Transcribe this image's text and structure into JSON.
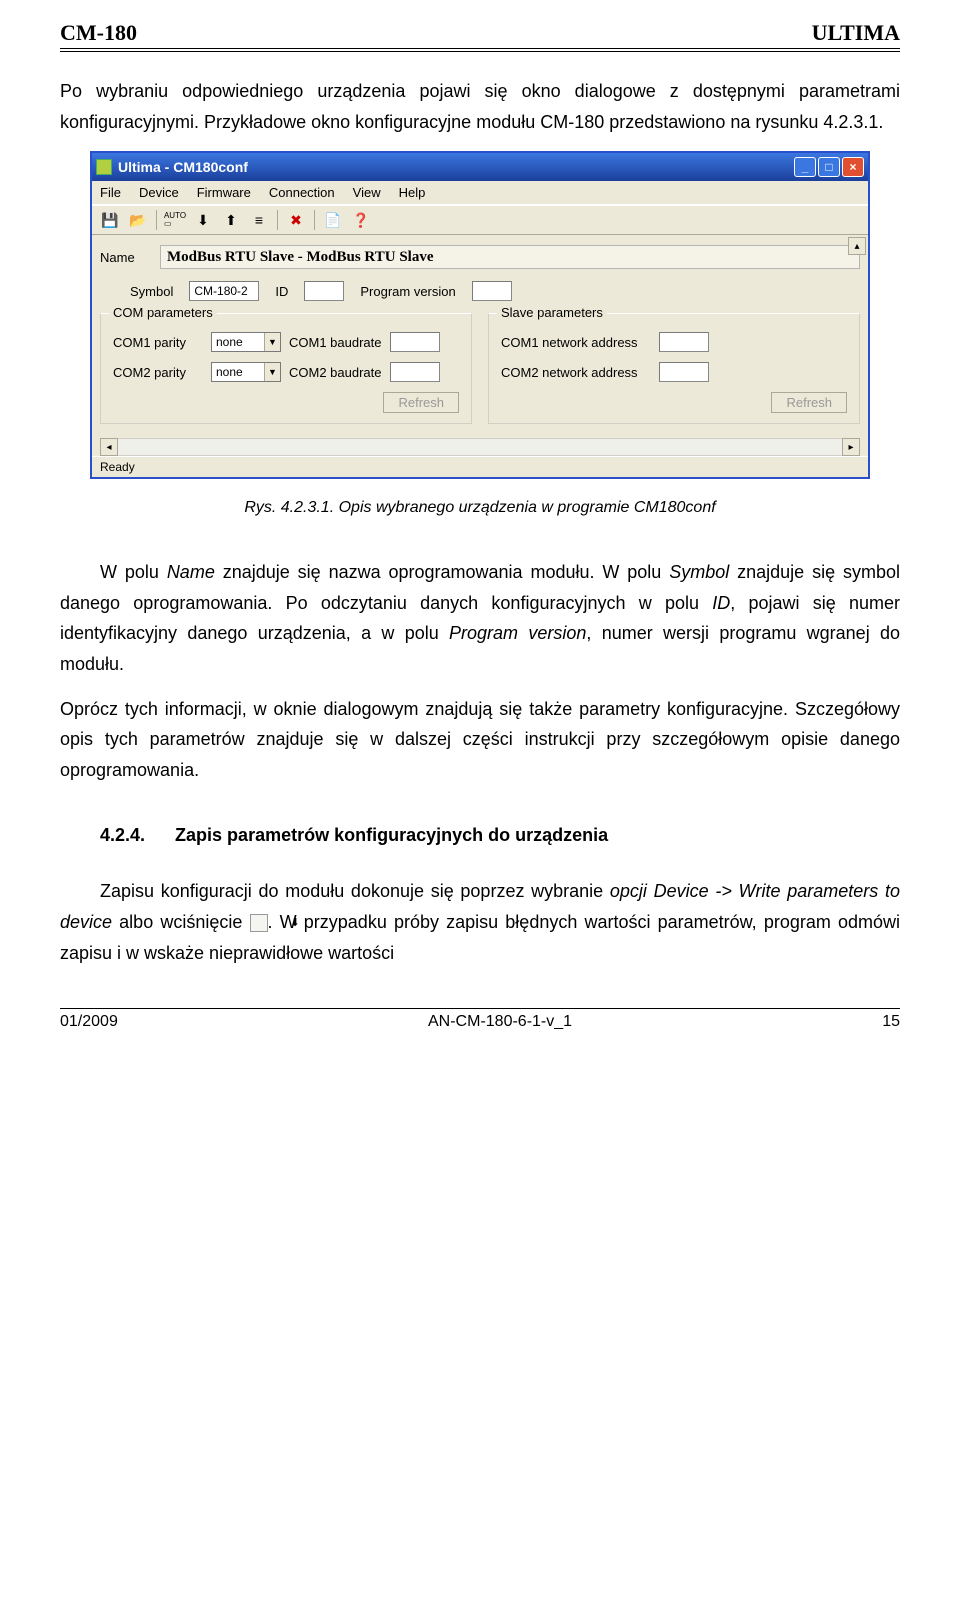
{
  "header": {
    "left": "CM-180",
    "right": "ULTIMA"
  },
  "intro": "Po wybraniu odpowiedniego urządzenia pojawi się okno dialogowe z dostępnymi parametrami konfiguracyjnymi. Przykładowe okno konfiguracyjne modułu CM-180 przedstawiono na rysunku 4.2.3.1.",
  "window": {
    "title": "Ultima - CM180conf",
    "menu": [
      "File",
      "Device",
      "Firmware",
      "Connection",
      "View",
      "Help"
    ],
    "toolbar_icons": [
      "save-icon",
      "open-icon",
      "auto-icon",
      "download-icon",
      "upload-icon",
      "verify-icon",
      "stop-icon",
      "doc-icon",
      "help-icon"
    ],
    "labels": {
      "name": "Name",
      "symbol": "Symbol",
      "id": "ID",
      "program_version": "Program version",
      "group_com": "COM parameters",
      "group_slave": "Slave parameters",
      "com1_parity": "COM1 parity",
      "com2_parity": "COM2 parity",
      "com1_baud": "COM1 baudrate",
      "com2_baud": "COM2 baudrate",
      "com1_addr": "COM1 network address",
      "com2_addr": "COM2 network address",
      "refresh": "Refresh"
    },
    "values": {
      "name": "ModBus RTU Slave - ModBus RTU Slave",
      "symbol": "CM-180-2",
      "id": "",
      "program_version": "",
      "com1_parity": "none",
      "com2_parity": "none",
      "com1_baud": "",
      "com2_baud": "",
      "com1_addr": "",
      "com2_addr": ""
    },
    "status": "Ready"
  },
  "caption": "Rys. 4.2.3.1. Opis wybranego urządzenia w programie CM180conf",
  "para2_a": "W polu ",
  "para2_name": "Name",
  "para2_b": " znajduje się nazwa oprogramowania modułu. W polu ",
  "para2_symbol": "Symbol",
  "para2_c": " znajduje się symbol danego oprogramowania. Po odczytaniu danych konfiguracyjnych w polu ",
  "para2_id": "ID",
  "para2_d": ", pojawi się numer identyfikacyjny danego urządzenia, a w polu ",
  "para2_pv": "Program version",
  "para2_e": ", numer wersji programu wgranej do modułu.",
  "para3": "Oprócz tych informacji, w oknie dialogowym znajdują się także parametry konfiguracyjne. Szczegółowy opis tych parametrów znajduje się w dalszej części instrukcji przy szczegółowym opisie danego oprogramowania.",
  "section": {
    "num": "4.2.4.",
    "title": "Zapis parametrów konfiguracyjnych do urządzenia"
  },
  "para4_a": "Zapisu konfiguracji do modułu dokonuje się poprzez wybranie ",
  "para4_opt": "opcji Device -> Write parameters to device",
  "para4_b": " albo wciśnięcie ",
  "para4_c": ". W przypadku próby zapisu błędnych wartości parametrów, program odmówi zapisu i w wskaże nieprawidłowe wartości",
  "footer": {
    "left": "01/2009",
    "center": "AN-CM-180-6-1-v_1",
    "right": "15"
  }
}
